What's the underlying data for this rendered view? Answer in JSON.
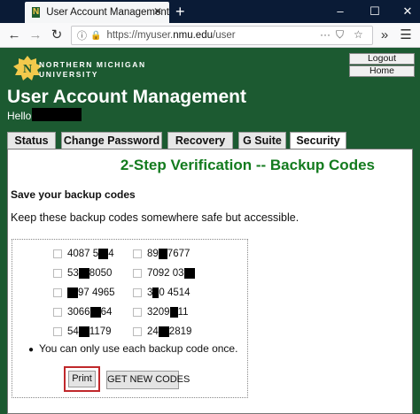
{
  "browser": {
    "tab_title": "User Account Management",
    "favicon_letter": "N",
    "new_tab_symbol": "+",
    "url_prefix": "https://myuser.",
    "url_domain": "nmu.edu",
    "url_path": "/user",
    "icons": [
      "back-icon",
      "forward-icon",
      "reload-icon",
      "info-icon",
      "lock-icon",
      "page-actions-icon",
      "pocket-icon",
      "bookmark-star-icon",
      "overflow-icon",
      "menu-icon",
      "minimize-icon",
      "maximize-icon",
      "close-icon"
    ]
  },
  "header": {
    "logo_line1": "NORTHERN MICHIGAN",
    "logo_line2": "UNIVERSITY",
    "logout_label": "Logout",
    "home_label": "Home",
    "title": "User Account Management",
    "hello_label": "Hello,"
  },
  "tabs": [
    {
      "label": "Status",
      "active": false
    },
    {
      "label": "Change Password",
      "active": false
    },
    {
      "label": "Recovery",
      "active": false
    },
    {
      "label": "G Suite",
      "active": false
    },
    {
      "label": "Security",
      "active": true
    }
  ],
  "content": {
    "title": "2-Step Verification -- Backup Codes",
    "section_heading": "Save your backup codes",
    "description": "Keep these backup codes somewhere safe but accessible.",
    "codes": [
      {
        "pre": "4087 5",
        "post": "4"
      },
      {
        "pre": "89",
        "post": "7677"
      },
      {
        "pre": "53",
        "post": " 8050"
      },
      {
        "pre": "7092 03",
        "post": ""
      },
      {
        "pre": "",
        "post": "97 4965"
      },
      {
        "pre": "3",
        "post": "0 4514"
      },
      {
        "pre": "3066 ",
        "post": "64"
      },
      {
        "pre": "3209 ",
        "post": "11"
      },
      {
        "pre": "54",
        "post": " 1179"
      },
      {
        "pre": "24",
        "post": " 2819"
      }
    ],
    "note": "You can only use each backup code once.",
    "print_label": "Print",
    "new_codes_label": "GET NEW CODES"
  },
  "colors": {
    "brand_green": "#1c5a31",
    "title_green": "#137b1e",
    "highlight_red": "#c0282b",
    "titlebar": "#0a1b36"
  }
}
